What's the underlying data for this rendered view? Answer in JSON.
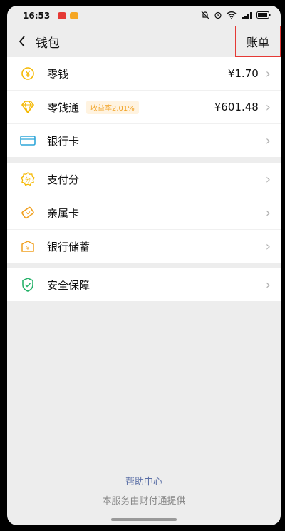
{
  "status_bar": {
    "time": "16:53",
    "battery_icon": "battery-icon",
    "wifi_icon": "wifi-icon",
    "signal_icon": "signal-icon",
    "alarm_icon": "alarm-icon",
    "mute_icon": "bell-mute-icon"
  },
  "header": {
    "title": "钱包",
    "bill_label": "账单"
  },
  "sections": {
    "balance": {
      "label": "零钱",
      "value": "¥1.70"
    },
    "lqt": {
      "label": "零钱通",
      "tag": "收益率2.01%",
      "value": "¥601.48"
    },
    "bank_card": {
      "label": "银行卡"
    },
    "pay_score": {
      "label": "支付分"
    },
    "family_card": {
      "label": "亲属卡"
    },
    "bank_savings": {
      "label": "银行储蓄"
    },
    "security": {
      "label": "安全保障"
    }
  },
  "footer": {
    "help": "帮助中心",
    "note": "本服务由财付通提供"
  },
  "colors": {
    "accent_yellow": "#f5b800",
    "accent_orange": "#f0a020",
    "accent_blue": "#2fa6d9",
    "accent_green": "#27b26a",
    "bill_border": "#e53935"
  }
}
